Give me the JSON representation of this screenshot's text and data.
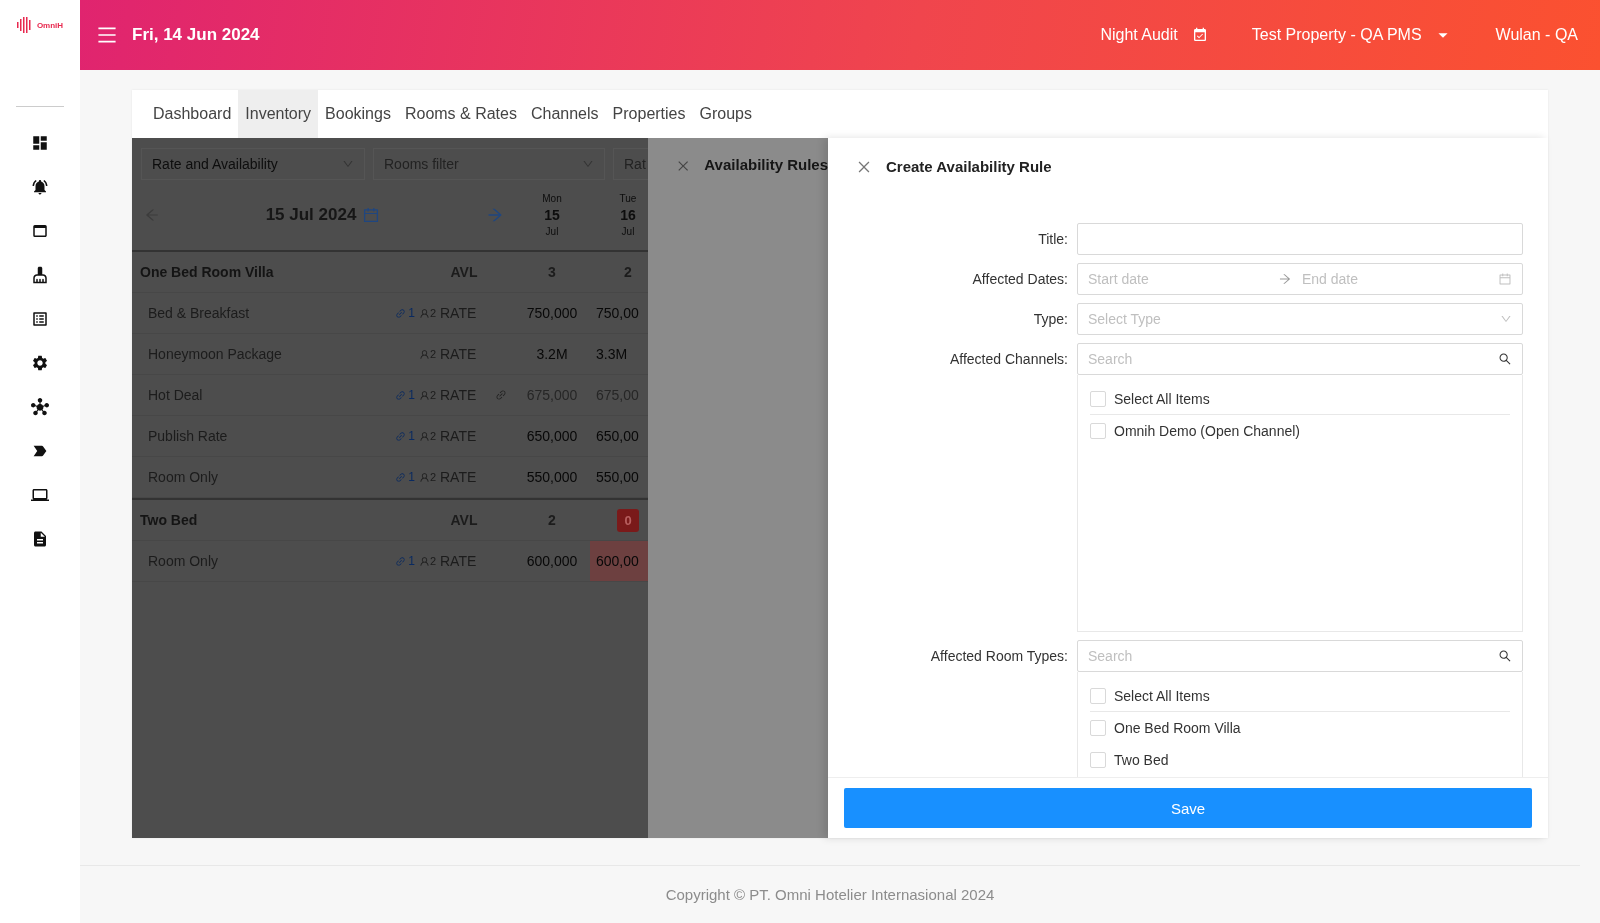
{
  "logo": {
    "text": "OmniH"
  },
  "header": {
    "date": "Fri, 14 Jun 2024",
    "night_audit": "Night Audit",
    "property": "Test Property - QA PMS",
    "user": "Wulan - QA"
  },
  "tabs": [
    {
      "label": "Dashboard",
      "selected": false
    },
    {
      "label": "Inventory",
      "selected": true
    },
    {
      "label": "Bookings",
      "selected": false
    },
    {
      "label": "Rooms & Rates",
      "selected": false
    },
    {
      "label": "Channels",
      "selected": false
    },
    {
      "label": "Properties",
      "selected": false
    },
    {
      "label": "Groups",
      "selected": false
    }
  ],
  "inventory": {
    "filters": [
      {
        "value": "Rate and Availability"
      },
      {
        "placeholder": "Rooms filter"
      },
      {
        "placeholder": "Rat"
      }
    ],
    "date": "15 Jul 2024",
    "days": [
      {
        "weekday": "Mon",
        "day": "15",
        "month": "Jul"
      },
      {
        "weekday": "Tue",
        "day": "16",
        "month": "Jul"
      }
    ],
    "room_types": [
      {
        "name": "One Bed Room Villa",
        "label": "AVL",
        "availability": [
          {
            "value": "3",
            "sold_out": false
          },
          {
            "value": "2",
            "sold_out": false
          }
        ],
        "rates": [
          {
            "name": "Bed & Breakfast",
            "link_count": "1",
            "occupancy": "2",
            "label": "RATE",
            "derived": false,
            "values": [
              {
                "value": "750,000",
                "sold_out": false
              },
              {
                "value": "750,00",
                "sold_out": false
              }
            ]
          },
          {
            "name": "Honeymoon Package",
            "occupancy": "2",
            "label": "RATE",
            "derived": false,
            "values": [
              {
                "value": "3.2M",
                "sold_out": false
              },
              {
                "value": "3.3M",
                "sold_out": false
              }
            ]
          },
          {
            "name": "Hot Deal",
            "link_count": "1",
            "occupancy": "2",
            "label": "RATE",
            "derived": true,
            "values": [
              {
                "value": "675,000",
                "sold_out": false
              },
              {
                "value": "675,00",
                "sold_out": false
              }
            ]
          },
          {
            "name": "Publish Rate",
            "link_count": "1",
            "occupancy": "2",
            "label": "RATE",
            "derived": false,
            "values": [
              {
                "value": "650,000",
                "sold_out": false
              },
              {
                "value": "650,00",
                "sold_out": false
              }
            ]
          },
          {
            "name": "Room Only",
            "link_count": "1",
            "occupancy": "2",
            "label": "RATE",
            "derived": false,
            "values": [
              {
                "value": "550,000",
                "sold_out": false
              },
              {
                "value": "550,00",
                "sold_out": false
              }
            ]
          }
        ]
      },
      {
        "name": "Two Bed",
        "label": "AVL",
        "availability": [
          {
            "value": "2",
            "sold_out": false
          },
          {
            "value": "0",
            "sold_out": true
          }
        ],
        "rates": [
          {
            "name": "Room Only",
            "link_count": "1",
            "occupancy": "2",
            "label": "RATE",
            "derived": false,
            "values": [
              {
                "value": "600,000",
                "sold_out": false
              },
              {
                "value": "600,00",
                "sold_out": true
              }
            ]
          }
        ]
      }
    ]
  },
  "availability_rules": {
    "title": "Availability Rules"
  },
  "create_rule": {
    "title": "Create Availability Rule",
    "fields": [
      {
        "kind": "text",
        "label": "Title:"
      },
      {
        "kind": "daterange",
        "label": "Affected Dates:",
        "start_placeholder": "Start date",
        "end_placeholder": "End date"
      },
      {
        "kind": "select",
        "label": "Type:",
        "placeholder": "Select Type"
      },
      {
        "kind": "checklist",
        "label": "Affected Channels:",
        "search_placeholder": "Search",
        "items": [
          {
            "label": "Select All Items",
            "checked": false
          },
          {
            "label": "Omnih Demo (Open Channel)",
            "checked": false
          }
        ]
      },
      {
        "kind": "checklist",
        "label": "Affected Room Types:",
        "search_placeholder": "Search",
        "items": [
          {
            "label": "Select All Items",
            "checked": false
          },
          {
            "label": "One Bed Room Villa",
            "checked": false
          },
          {
            "label": "Two Bed",
            "checked": false
          }
        ]
      }
    ],
    "save_label": "Save"
  },
  "footer": {
    "copyright": "Copyright © PT. Omni Hotelier Internasional 2024"
  }
}
